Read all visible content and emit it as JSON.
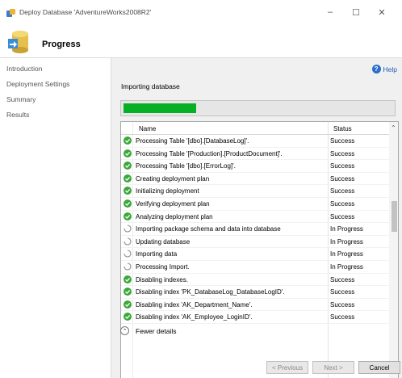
{
  "window": {
    "title": "Deploy Database 'AdventureWorks2008R2'",
    "controls": {
      "minimize": "–",
      "maximize": "☐",
      "close": "✕"
    }
  },
  "header": {
    "title": "Progress"
  },
  "nav": {
    "items": [
      {
        "label": "Introduction"
      },
      {
        "label": "Deployment Settings"
      },
      {
        "label": "Summary"
      },
      {
        "label": "Results"
      }
    ]
  },
  "help": {
    "label": "Help",
    "icon": "?"
  },
  "status": {
    "label": "Importing database"
  },
  "progress": {
    "fraction": 0.27,
    "color": "#06b025"
  },
  "table": {
    "columns": {
      "name": "Name",
      "status": "Status"
    },
    "rows": [
      {
        "icon": "success",
        "name": "Processing Table '[dbo].[DatabaseLog]'.",
        "status": "Success"
      },
      {
        "icon": "success",
        "name": "Processing Table '[Production].[ProductDocument]'.",
        "status": "Success"
      },
      {
        "icon": "success",
        "name": "Processing Table '[dbo].[ErrorLog]'.",
        "status": "Success"
      },
      {
        "icon": "success",
        "name": "Creating deployment plan",
        "status": "Success"
      },
      {
        "icon": "success",
        "name": "Initializing deployment",
        "status": "Success"
      },
      {
        "icon": "success",
        "name": "Verifying deployment plan",
        "status": "Success"
      },
      {
        "icon": "success",
        "name": "Analyzing deployment plan",
        "status": "Success"
      },
      {
        "icon": "progress",
        "name": "Importing package schema and data into database",
        "status": "In Progress"
      },
      {
        "icon": "progress",
        "name": "Updating database",
        "status": "In Progress"
      },
      {
        "icon": "progress",
        "name": "Importing data",
        "status": "In Progress"
      },
      {
        "icon": "progress",
        "name": "Processing Import.",
        "status": "In Progress"
      },
      {
        "icon": "success",
        "name": "Disabling indexes.",
        "status": "Success"
      },
      {
        "icon": "success",
        "name": "Disabling index 'PK_DatabaseLog_DatabaseLogID'.",
        "status": "Success"
      },
      {
        "icon": "success",
        "name": "Disabling index 'AK_Department_Name'.",
        "status": "Success"
      },
      {
        "icon": "success",
        "name": "Disabling index 'AK_Employee_LoginID'.",
        "status": "Success"
      }
    ]
  },
  "fewer_details": {
    "label": "Fewer details",
    "icon": "⌃"
  },
  "buttons": {
    "previous": "< Previous",
    "next": "Next >",
    "cancel": "Cancel"
  },
  "colors": {
    "success": "#3aa83a",
    "accent": "#06b025",
    "link": "#1a5fb4"
  }
}
